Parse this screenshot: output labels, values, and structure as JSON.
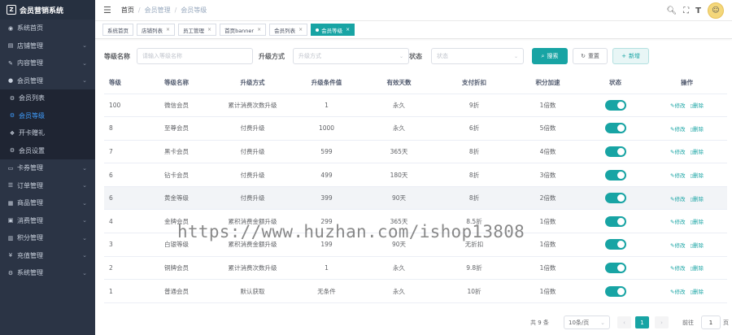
{
  "app": {
    "title": "会员营销系统"
  },
  "sidebar": {
    "items": [
      {
        "label": "系统首页",
        "icon": "dashboard-icon",
        "chevron": false
      },
      {
        "label": "店铺管理",
        "icon": "store-icon",
        "chevron": true
      },
      {
        "label": "内容管理",
        "icon": "edit-icon",
        "chevron": true
      },
      {
        "label": "会员管理",
        "icon": "user-icon",
        "chevron": true
      }
    ],
    "submenu": [
      {
        "label": "会员列表",
        "icon": "settings-icon",
        "active": false
      },
      {
        "label": "会员等级",
        "icon": "settings-icon",
        "active": true
      },
      {
        "label": "开卡赠礼",
        "icon": "gift-icon",
        "active": false
      },
      {
        "label": "会员设置",
        "icon": "settings-icon",
        "active": false
      }
    ],
    "items_after": [
      {
        "label": "卡券管理",
        "icon": "coupon-icon"
      },
      {
        "label": "订单管理",
        "icon": "order-icon"
      },
      {
        "label": "商品管理",
        "icon": "goods-icon"
      },
      {
        "label": "消费管理",
        "icon": "message-icon"
      },
      {
        "label": "积分管理",
        "icon": "points-icon"
      },
      {
        "label": "充值管理",
        "icon": "yen-icon"
      },
      {
        "label": "系统管理",
        "icon": "gear-icon"
      }
    ]
  },
  "header": {
    "breadcrumb": [
      "首页",
      "会员管理",
      "会员等级"
    ]
  },
  "tags": [
    {
      "label": "系统首页",
      "closable": false,
      "active": false
    },
    {
      "label": "店铺列表",
      "closable": true,
      "active": false
    },
    {
      "label": "员工管理",
      "closable": true,
      "active": false
    },
    {
      "label": "首页banner",
      "closable": true,
      "active": false
    },
    {
      "label": "会员列表",
      "closable": true,
      "active": false
    },
    {
      "label": "会员等级",
      "closable": true,
      "active": true
    }
  ],
  "filter": {
    "name_label": "等级名称",
    "name_placeholder": "请输入等级名称",
    "upgrade_label": "升级方式",
    "upgrade_placeholder": "升级方式",
    "status_label": "状态",
    "status_placeholder": "状态",
    "search_label": "搜索",
    "reset_label": "重置",
    "add_label": "新增"
  },
  "table": {
    "columns": [
      "等级",
      "等级名称",
      "升级方式",
      "升级条件值",
      "有效天数",
      "支付折扣",
      "积分加速",
      "状态",
      "操作"
    ],
    "rows": [
      [
        "100",
        "微信会员",
        "累计消费次数升级",
        "1",
        "永久",
        "9折",
        "1倍数"
      ],
      [
        "8",
        "至尊会员",
        "付费升级",
        "1000",
        "永久",
        "6折",
        "5倍数"
      ],
      [
        "7",
        "黑卡会员",
        "付费升级",
        "599",
        "365天",
        "8折",
        "4倍数"
      ],
      [
        "6",
        "钻卡会员",
        "付费升级",
        "499",
        "180天",
        "8折",
        "3倍数"
      ],
      [
        "6",
        "黄金等级",
        "付费升级",
        "399",
        "90天",
        "8折",
        "2倍数"
      ],
      [
        "4",
        "金牌会员",
        "累积消费金额升级",
        "299",
        "365天",
        "8.5折",
        "1倍数"
      ],
      [
        "3",
        "白银等级",
        "累积消费金额升级",
        "199",
        "90天",
        "无折扣",
        "1倍数"
      ],
      [
        "2",
        "铜牌会员",
        "累计消费次数升级",
        "1",
        "永久",
        "9.8折",
        "1倍数"
      ],
      [
        "1",
        "普通会员",
        "默认获取",
        "无条件",
        "永久",
        "10折",
        "1倍数"
      ]
    ],
    "edit_label": "修改",
    "delete_label": "删除",
    "highlight_row": 4
  },
  "pagination": {
    "total": "共 9 条",
    "page_size": "10条/页",
    "current": "1",
    "goto_label": "前往",
    "goto_value": "1",
    "page_unit": "页"
  },
  "watermark": "https://www.huzhan.com/ishop13808",
  "colors": {
    "accent": "#18a4a4",
    "sidebar": "#2b3445"
  }
}
